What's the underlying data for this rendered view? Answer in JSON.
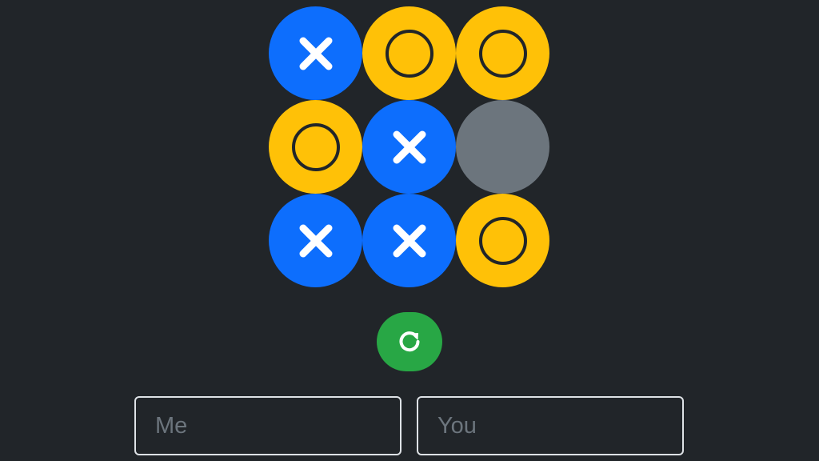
{
  "colors": {
    "background": "#212529",
    "x_cell": "#0d6efd",
    "o_cell": "#ffc107",
    "empty_cell": "#6c757d",
    "x_mark": "#ffffff",
    "o_ring": "#212529",
    "reset_button": "#28a745",
    "reset_icon": "#ffffff",
    "input_border": "#dee2e6",
    "placeholder": "#6c757d"
  },
  "board": {
    "cells": [
      "X",
      "O",
      "O",
      "O",
      "X",
      "",
      "X",
      "X",
      "O"
    ]
  },
  "controls": {
    "reset_icon": "rotate-cw-icon"
  },
  "players": {
    "player_one": {
      "placeholder": "Me",
      "value": ""
    },
    "player_two": {
      "placeholder": "You",
      "value": ""
    }
  }
}
